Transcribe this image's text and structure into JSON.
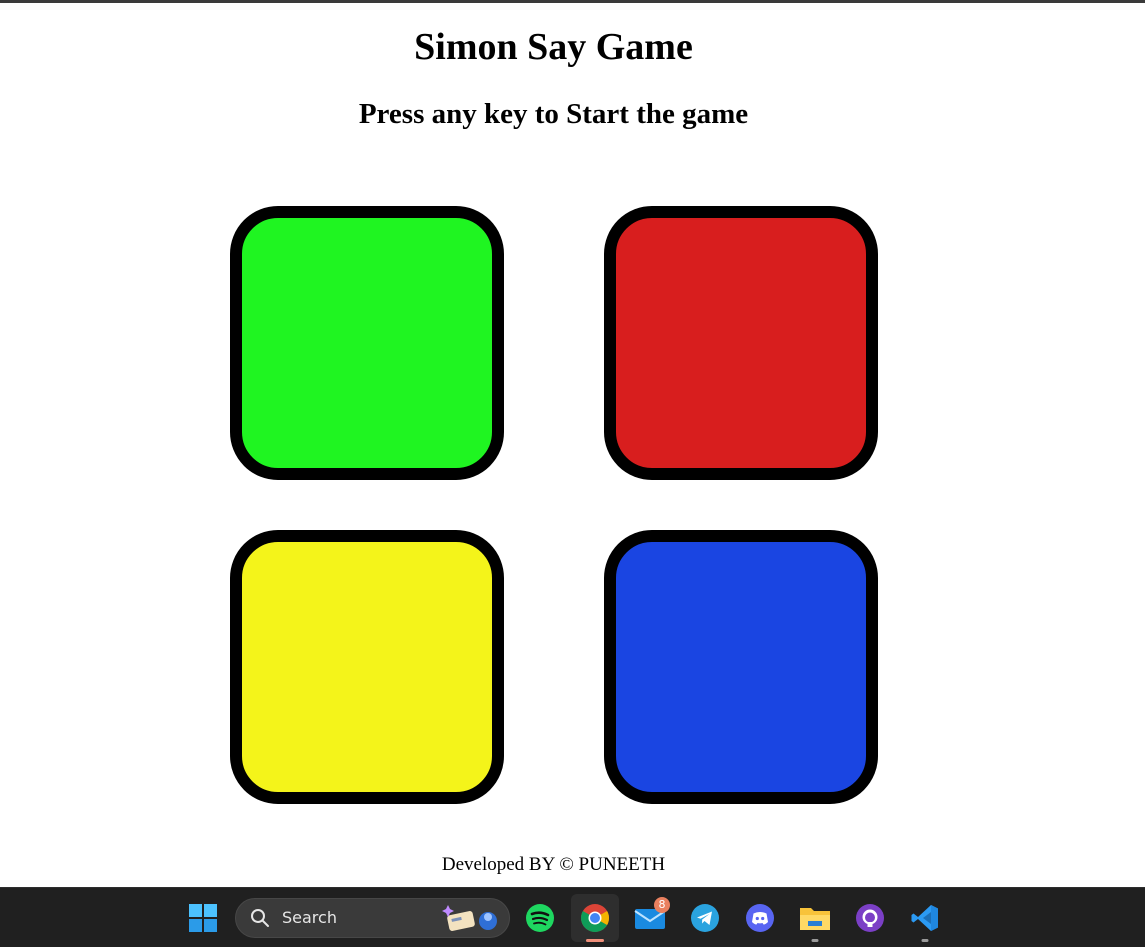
{
  "game": {
    "title": "Simon Say Game",
    "status": "Press any key to Start the game",
    "buttons": [
      {
        "id": "green",
        "color": "#1ff521"
      },
      {
        "id": "red",
        "color": "#d81e1e"
      },
      {
        "id": "yellow",
        "color": "#f4f41a"
      },
      {
        "id": "blue",
        "color": "#1a45e2"
      }
    ],
    "footer": "Developed BY © PUNEETH"
  },
  "taskbar": {
    "search_label": "Search",
    "mail_badge": "8",
    "apps": [
      "start-icon",
      "search-icon",
      "spotify-icon",
      "chrome-icon",
      "mail-icon",
      "telegram-icon",
      "discord-icon",
      "file-explorer-icon",
      "github-icon",
      "vscode-icon"
    ]
  }
}
